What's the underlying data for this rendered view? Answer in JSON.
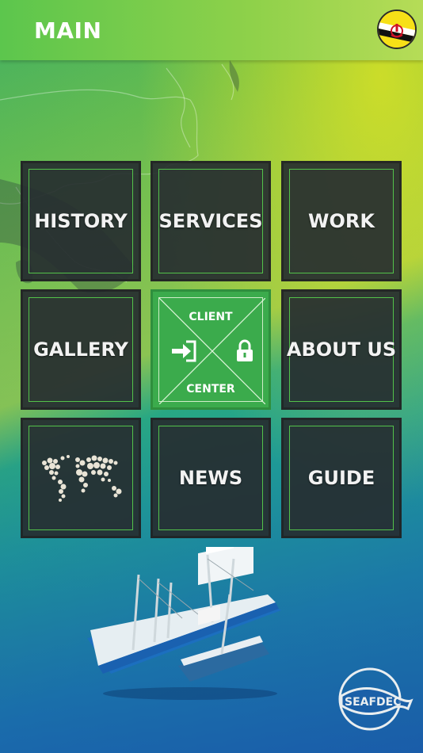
{
  "header": {
    "title": "MAIN",
    "flag_icon": "brunei-flag-icon"
  },
  "menu": {
    "history": "HISTORY",
    "services": "SERVICES",
    "work": "WORK",
    "gallery": "GALLERY",
    "client_top": "CLIENT",
    "client_bottom": "CENTER",
    "about": "ABOUT US",
    "news": "NEWS",
    "guide": "GUIDE"
  },
  "icons": {
    "client_login": "login-icon",
    "client_lock": "lock-icon",
    "world_map": "world-map-icon"
  },
  "colors": {
    "header": "#6cc94d",
    "tile": "#262d30",
    "tile_border": "#53c24a",
    "client_tile": "#3bab4c"
  },
  "footer": {
    "logo_text": "SEAFDEC"
  }
}
